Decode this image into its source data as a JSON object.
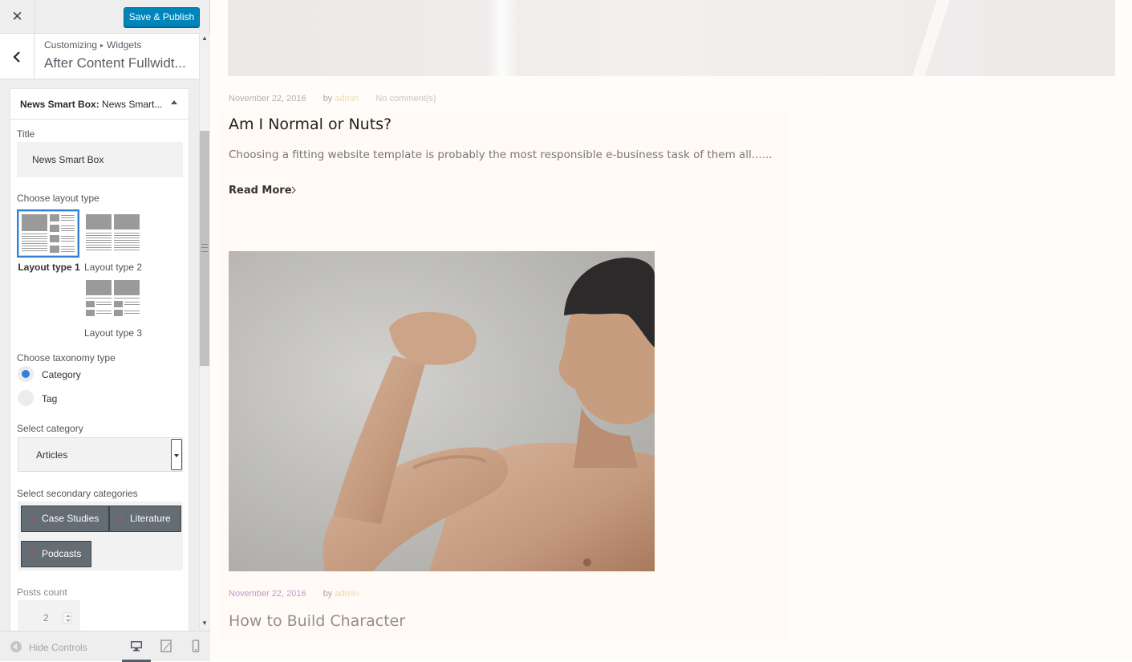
{
  "topbar": {
    "close_icon": "close-icon",
    "publish_label": "Save & Publish"
  },
  "section": {
    "breadcrumb_root": "Customizing",
    "breadcrumb_sep": "▸",
    "breadcrumb_leaf": "Widgets",
    "title": "After Content Fullwidt..."
  },
  "widget": {
    "name_bold": "News Smart Box:",
    "name_sub": "News Smart...",
    "title_label": "Title",
    "title_value": "News Smart Box",
    "layout_label": "Choose layout type",
    "layouts": [
      {
        "label": "Layout type 1",
        "selected": true
      },
      {
        "label": "Layout type 2",
        "selected": false
      },
      {
        "label": "Layout type 3",
        "selected": false
      }
    ],
    "taxonomy_label": "Choose taxonomy type",
    "taxonomy_options": [
      {
        "label": "Category",
        "checked": true
      },
      {
        "label": "Tag",
        "checked": false
      }
    ],
    "category_label": "Select category",
    "category_value": "Articles",
    "secondary_label": "Select secondary categories",
    "secondary_tags": [
      "Case Studies",
      "Literature",
      "Podcasts"
    ],
    "tag_remove_glyph": "×",
    "posts_count_label": "Posts count",
    "posts_count_value": "2"
  },
  "footer": {
    "hide_label": "Hide Controls",
    "devices": [
      "desktop-icon",
      "tablet-icon",
      "mobile-icon"
    ],
    "active_device": "desktop"
  },
  "preview": {
    "post1": {
      "date": "November 22, 2016",
      "by": "by",
      "author": "admin",
      "comments": "No comment(s)",
      "title": "Am I Normal or Nuts?",
      "excerpt": "Choosing a fitting website template is probably the most responsible e-business task of them all......",
      "read_more": "Read More"
    },
    "post2": {
      "date": "November 22, 2016",
      "by": "by",
      "author": "admin",
      "title": "How to Build Character"
    }
  },
  "colors": {
    "publish_blue": "#0085ba",
    "radio_blue": "#2e81e0",
    "tag_gray": "#646c74",
    "tag_remove_red": "#e14d43",
    "preview_bg": "#fffdfa"
  }
}
